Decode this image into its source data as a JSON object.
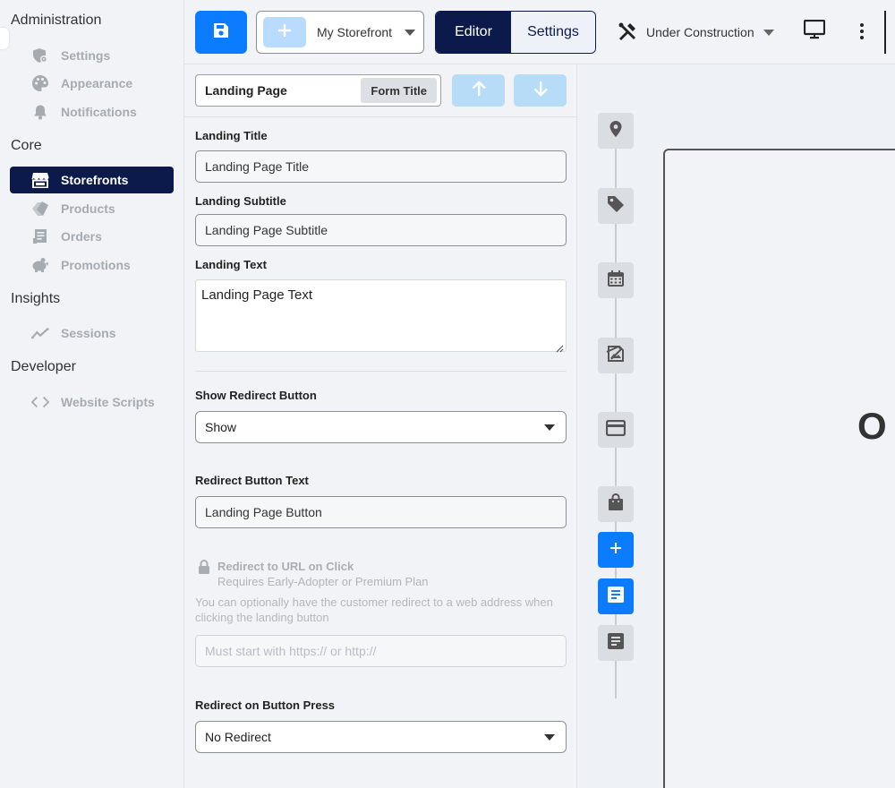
{
  "sidebar": {
    "sections": [
      {
        "title": "Administration",
        "items": [
          {
            "label": "Settings",
            "icon": "shield-gear-icon"
          },
          {
            "label": "Appearance",
            "icon": "palette-icon"
          },
          {
            "label": "Notifications",
            "icon": "bell-icon"
          }
        ]
      },
      {
        "title": "Core",
        "items": [
          {
            "label": "Storefronts",
            "icon": "store-icon",
            "active": true
          },
          {
            "label": "Products",
            "icon": "tags-icon"
          },
          {
            "label": "Orders",
            "icon": "receipt-icon"
          },
          {
            "label": "Promotions",
            "icon": "piggy-bank-icon"
          }
        ]
      },
      {
        "title": "Insights",
        "items": [
          {
            "label": "Sessions",
            "icon": "chart-line-icon"
          }
        ]
      },
      {
        "title": "Developer",
        "items": [
          {
            "label": "Website Scripts",
            "icon": "code-icon"
          }
        ]
      }
    ]
  },
  "toolbar": {
    "storefront_name": "My Storefront",
    "tabs": [
      {
        "label": "Editor",
        "active": true
      },
      {
        "label": "Settings",
        "active": false
      }
    ],
    "status": "Under Construction"
  },
  "form": {
    "section_value": "Landing Page",
    "section_label": "Form Title",
    "landing_title_label": "Landing Title",
    "landing_title_value": "Landing Page Title",
    "landing_subtitle_label": "Landing Subtitle",
    "landing_subtitle_value": "Landing Page Subtitle",
    "landing_text_label": "Landing Text",
    "landing_text_value": "Landing Page Text",
    "show_redirect_label": "Show Redirect Button",
    "show_redirect_value": "Show",
    "redirect_text_label": "Redirect Button Text",
    "redirect_text_value": "Landing Page Button",
    "redirect_url_title": "Redirect to URL on Click",
    "redirect_url_requirement": "Requires Early-Adopter or Premium Plan",
    "redirect_url_help": "You can optionally have the customer redirect to a web address when clicking the landing button",
    "redirect_url_placeholder": "Must start with https:// or http://",
    "redirect_press_label": "Redirect on Button Press",
    "redirect_press_value": "No Redirect"
  },
  "preview": {
    "canvas_text": "O",
    "timeline_icons": [
      "map-pin-icon",
      "tag-icon",
      "calendar-icon",
      "image-edit-icon",
      "credit-card-icon",
      "shopping-bag-icon",
      "plus-icon",
      "document-icon",
      "document-icon"
    ]
  },
  "colors": {
    "primary": "#0b7bff",
    "navy": "#0b1a4a",
    "light_blue": "#b6dcf7",
    "background": "#f1f3f6"
  }
}
